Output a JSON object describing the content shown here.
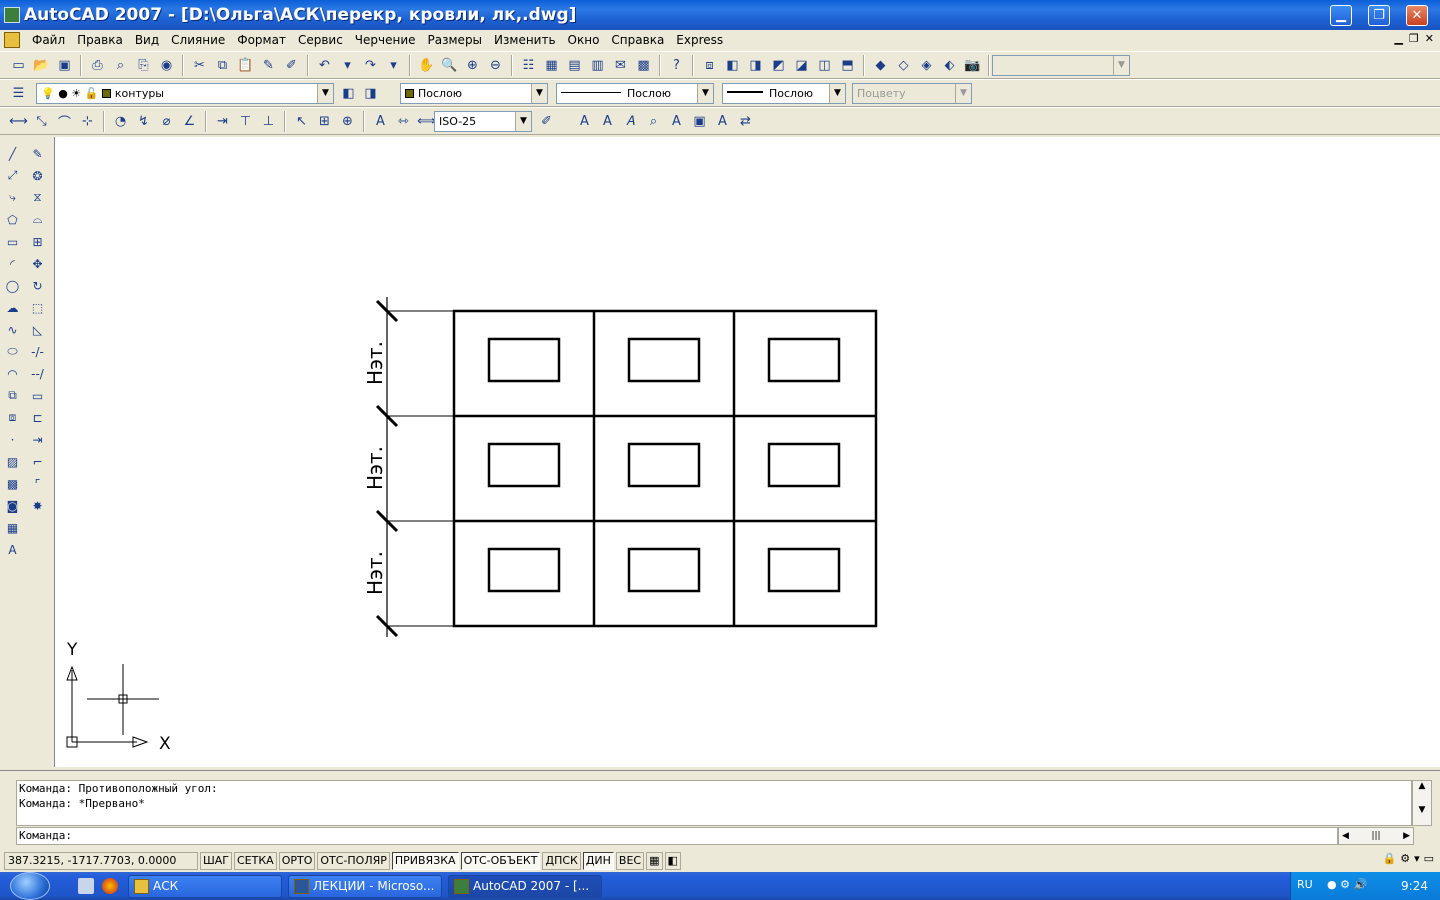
{
  "window": {
    "title": "AutoCAD 2007 - [D:\\Ольга\\АСК\\перекр, кровли, лк,.dwg]",
    "minimize": "▁",
    "maximize": "❐",
    "close": "✕"
  },
  "menu": {
    "items": [
      "Файл",
      "Правка",
      "Вид",
      "Слияние",
      "Формат",
      "Сервис",
      "Черчение",
      "Размеры",
      "Изменить",
      "Окно",
      "Справка",
      "Express"
    ]
  },
  "toolbars": {
    "layer_combo": "контуры",
    "color_combo": "Послою",
    "linetype_combo": "Послою",
    "lineweight_combo": "Послою",
    "plotstyle_combo": "Поцвету",
    "dimstyle_combo": "ISO-25"
  },
  "drawing": {
    "dim_label": "Hэт.",
    "ucs_y": "Y",
    "ucs_x": "X"
  },
  "command": {
    "history": [
      "Команда: Противоположный угол:",
      "Команда: *Прервано*"
    ],
    "prompt": "Команда:"
  },
  "status": {
    "coords": "387.3215, -1717.7703, 0.0000",
    "buttons": [
      {
        "label": "ШАГ",
        "on": false
      },
      {
        "label": "СЕТКА",
        "on": false
      },
      {
        "label": "ОРТО",
        "on": false
      },
      {
        "label": "ОТС-ПОЛЯР",
        "on": false
      },
      {
        "label": "ПРИВЯЗКА",
        "on": true
      },
      {
        "label": "ОТС-ОБЪЕКТ",
        "on": true
      },
      {
        "label": "ДПСК",
        "on": false
      },
      {
        "label": "ДИН",
        "on": true
      },
      {
        "label": "ВЕС",
        "on": false
      }
    ]
  },
  "taskbar": {
    "tasks": [
      "АСК",
      "ЛЕКЦИИ - Microso...",
      "AutoCAD 2007 - [..."
    ],
    "lang": "RU",
    "clock": "9:24"
  },
  "colors": {
    "titlebar": "#1c5fd0",
    "layer_swatch": "#6b6b00",
    "taskbar": "#245edb"
  }
}
